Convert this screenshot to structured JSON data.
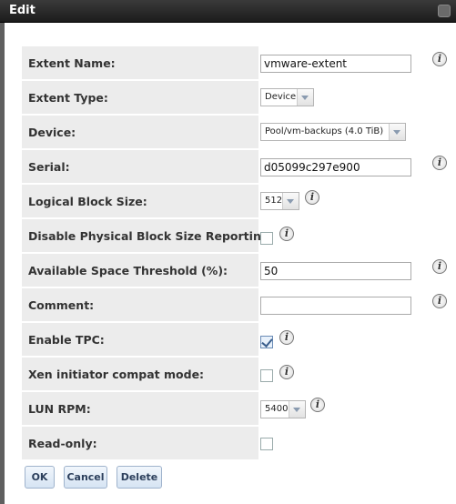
{
  "dialog": {
    "title": "Edit"
  },
  "icons": {
    "close": "close-icon",
    "info": "info-icon"
  },
  "colors": {
    "titlebar": "#1c1c1c",
    "row_bg": "#ececec",
    "button_text": "#2c3f5c"
  },
  "form": {
    "extent_name": {
      "label": "Extent Name:",
      "value": "vmware-extent"
    },
    "extent_type": {
      "label": "Extent Type:",
      "value": "Device"
    },
    "device": {
      "label": "Device:",
      "value": "Pool/vm-backups (4.0 TiB)"
    },
    "serial": {
      "label": "Serial:",
      "value": "d05099c297e900"
    },
    "logical_block_size": {
      "label": "Logical Block Size:",
      "value": "512"
    },
    "disable_pbs_reporting": {
      "label": "Disable Physical Block Size Reporting:",
      "checked": false
    },
    "avail_space_threshold": {
      "label": "Available Space Threshold (%):",
      "value": "50"
    },
    "comment": {
      "label": "Comment:",
      "value": ""
    },
    "enable_tpc": {
      "label": "Enable TPC:",
      "checked": true
    },
    "xen_compat": {
      "label": "Xen initiator compat mode:",
      "checked": false
    },
    "lun_rpm": {
      "label": "LUN RPM:",
      "value": "5400"
    },
    "read_only": {
      "label": "Read-only:",
      "checked": false
    }
  },
  "buttons": {
    "ok": "OK",
    "cancel": "Cancel",
    "delete": "Delete"
  },
  "info_glyph": "i"
}
